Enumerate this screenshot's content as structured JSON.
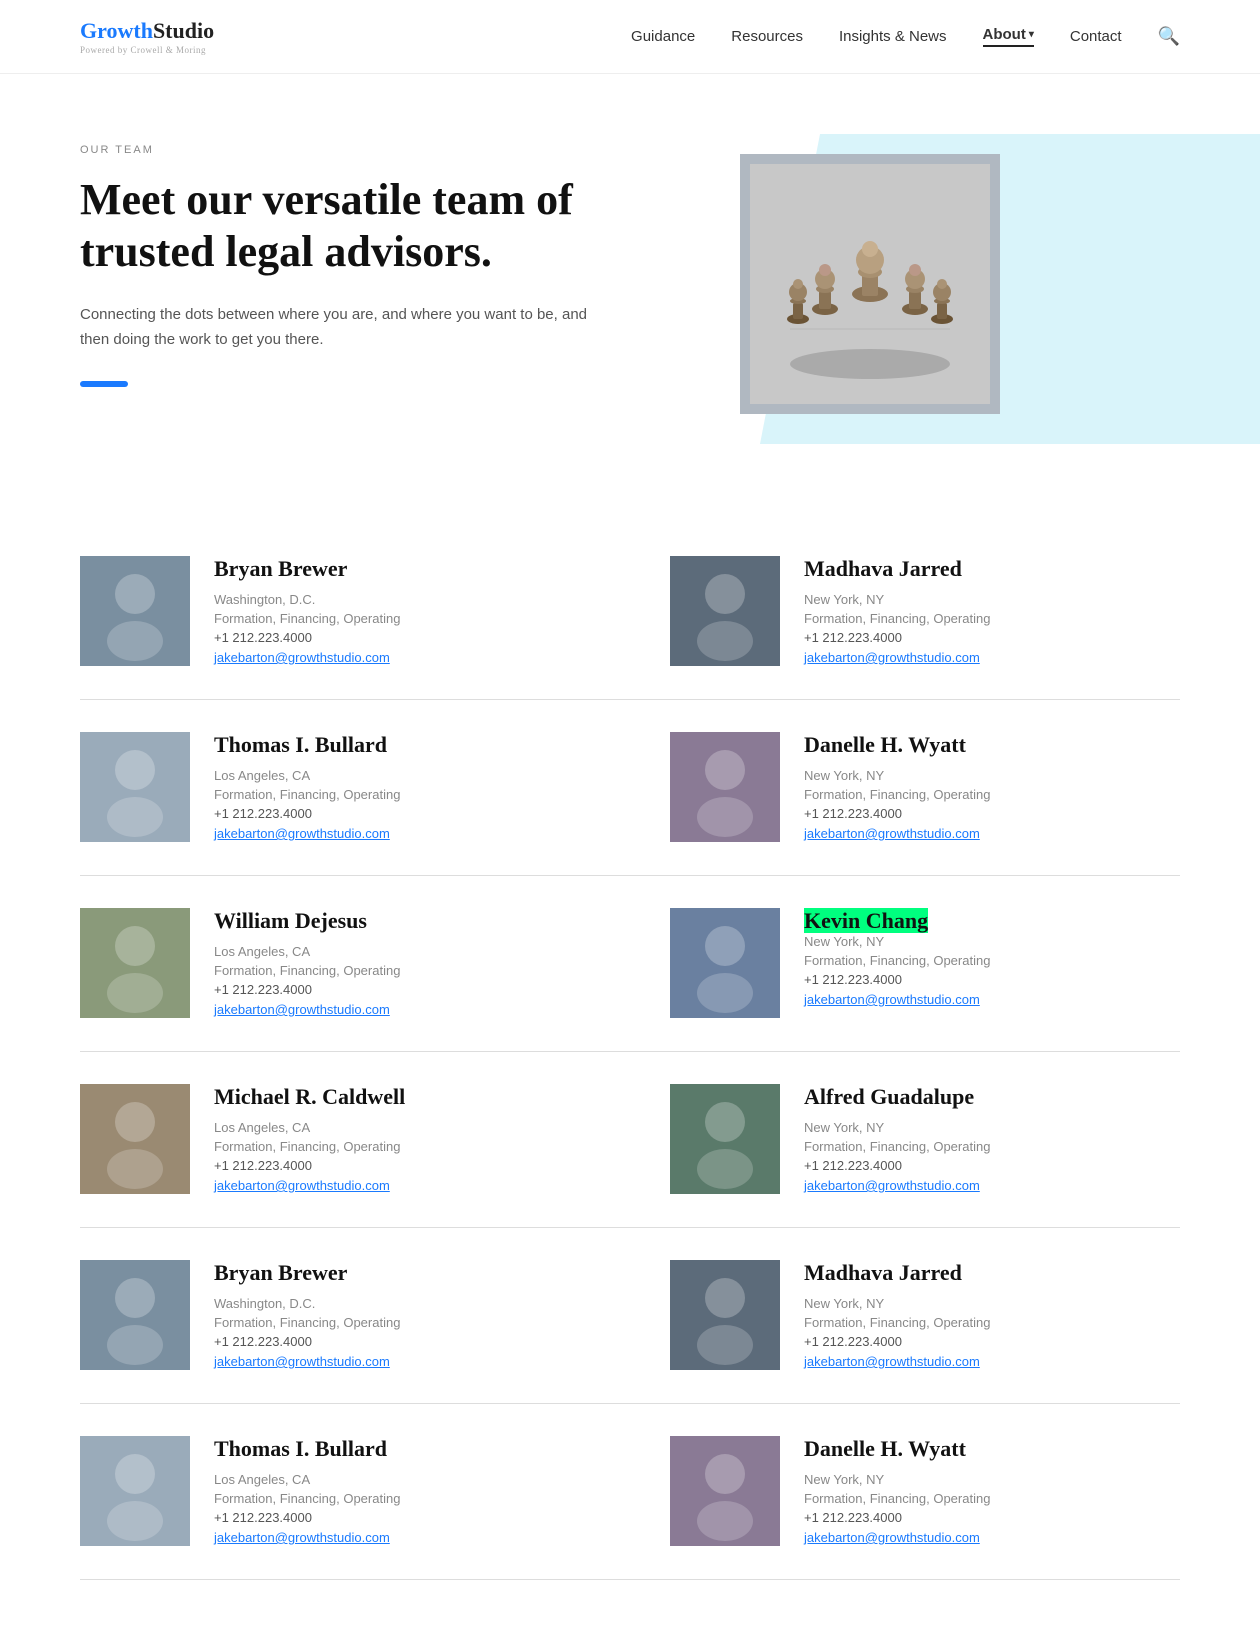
{
  "nav": {
    "logo_growth": "Growth",
    "logo_studio": "Studio",
    "logo_sub": "Powered by Crowell & Moring",
    "links": [
      {
        "label": "Guidance",
        "active": false
      },
      {
        "label": "Resources",
        "active": false
      },
      {
        "label": "Insights & News",
        "active": false
      },
      {
        "label": "About",
        "active": true,
        "has_arrow": true
      },
      {
        "label": "Contact",
        "active": false
      }
    ]
  },
  "hero": {
    "label": "OUR TEAM",
    "title": "Meet our versatile team of trusted legal advisors.",
    "description": "Connecting the dots between where you are, and where you want to be, and then doing the work to get you there."
  },
  "team": {
    "members": [
      {
        "name": "Bryan Brewer",
        "location": "Washington, D.C.",
        "specialty": "Formation, Financing, Operating",
        "phone": "+1 212.223.4000",
        "email": "jakebarton@growthstudio.com",
        "photo_class": "photo-1",
        "highlighted": false
      },
      {
        "name": "Madhava Jarred",
        "location": "New York, NY",
        "specialty": "Formation, Financing, Operating",
        "phone": "+1 212.223.4000",
        "email": "jakebarton@growthstudio.com",
        "photo_class": "photo-2",
        "highlighted": false
      },
      {
        "name": "Thomas I. Bullard",
        "location": "Los Angeles, CA",
        "specialty": "Formation, Financing, Operating",
        "phone": "+1 212.223.4000",
        "email": "jakebarton@growthstudio.com",
        "photo_class": "photo-3",
        "highlighted": false
      },
      {
        "name": "Danelle H. Wyatt",
        "location": "New York, NY",
        "specialty": "Formation, Financing, Operating",
        "phone": "+1 212.223.4000",
        "email": "jakebarton@growthstudio.com",
        "photo_class": "photo-4",
        "highlighted": false
      },
      {
        "name": "William Dejesus",
        "location": "Los Angeles, CA",
        "specialty": "Formation, Financing, Operating",
        "phone": "+1 212.223.4000",
        "email": "jakebarton@growthstudio.com",
        "photo_class": "photo-5",
        "highlighted": false
      },
      {
        "name": "Kevin Chang",
        "location": "New York, NY",
        "specialty": "Formation, Financing, Operating",
        "phone": "+1 212.223.4000",
        "email": "jakebarton@growthstudio.com",
        "photo_class": "photo-6",
        "highlighted": true
      },
      {
        "name": "Michael R. Caldwell",
        "location": "Los Angeles, CA",
        "specialty": "Formation, Financing, Operating",
        "phone": "+1 212.223.4000",
        "email": "jakebarton@growthstudio.com",
        "photo_class": "photo-7",
        "highlighted": false
      },
      {
        "name": "Alfred Guadalupe",
        "location": "New York, NY",
        "specialty": "Formation, Financing, Operating",
        "phone": "+1 212.223.4000",
        "email": "jakebarton@growthstudio.com",
        "photo_class": "photo-8",
        "highlighted": false
      },
      {
        "name": "Bryan Brewer",
        "location": "Washington, D.C.",
        "specialty": "Formation, Financing, Operating",
        "phone": "+1 212.223.4000",
        "email": "jakebarton@growthstudio.com",
        "photo_class": "photo-9",
        "highlighted": false
      },
      {
        "name": "Madhava Jarred",
        "location": "New York, NY",
        "specialty": "Formation, Financing, Operating",
        "phone": "+1 212.223.4000",
        "email": "jakebarton@growthstudio.com",
        "photo_class": "photo-10",
        "highlighted": false
      },
      {
        "name": "Thomas I. Bullard",
        "location": "Los Angeles, CA",
        "specialty": "Formation, Financing, Operating",
        "phone": "+1 212.223.4000",
        "email": "jakebarton@growthstudio.com",
        "photo_class": "photo-11",
        "highlighted": false
      },
      {
        "name": "Danelle H. Wyatt",
        "location": "New York, NY",
        "specialty": "Formation, Financing, Operating",
        "phone": "+1 212.223.4000",
        "email": "jakebarton@growthstudio.com",
        "photo_class": "photo-12",
        "highlighted": false
      }
    ]
  }
}
